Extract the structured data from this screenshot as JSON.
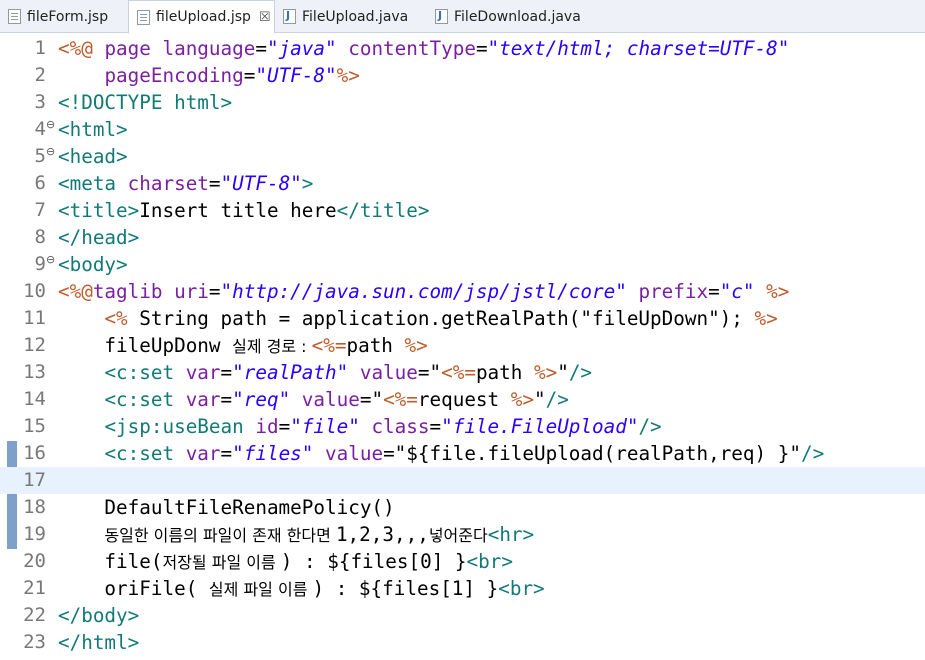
{
  "tabs": [
    {
      "label": "fileForm.jsp",
      "icon": "jsp-file-icon",
      "active": false
    },
    {
      "label": "fileUpload.jsp",
      "icon": "jsp-file-icon",
      "active": true,
      "close": "☒"
    },
    {
      "label": "FileUpload.java",
      "icon": "java-file-icon",
      "active": false
    },
    {
      "label": "FileDownload.java",
      "icon": "java-file-icon",
      "active": false
    }
  ],
  "editor": {
    "current_line": 17,
    "lines": [
      {
        "n": "1",
        "tokens": [
          [
            "dir",
            "<%@ "
          ],
          [
            "attr",
            "page "
          ],
          [
            "attr",
            "language"
          ],
          [
            "plain",
            "="
          ],
          [
            "str",
            "\"java\""
          ],
          [
            "plain",
            " "
          ],
          [
            "attr",
            "contentType"
          ],
          [
            "plain",
            "="
          ],
          [
            "str",
            "\"text/html; charset=UTF-8\""
          ]
        ]
      },
      {
        "n": "2",
        "tokens": [
          [
            "plain",
            "    "
          ],
          [
            "attr",
            "pageEncoding"
          ],
          [
            "plain",
            "="
          ],
          [
            "str",
            "\"UTF-8\""
          ],
          [
            "dir",
            "%>"
          ]
        ]
      },
      {
        "n": "3",
        "tokens": [
          [
            "tag",
            "<!DOCTYPE html>"
          ]
        ]
      },
      {
        "n": "4",
        "fold": "⊖",
        "tokens": [
          [
            "tag",
            "<html>"
          ]
        ]
      },
      {
        "n": "5",
        "fold": "⊖",
        "tokens": [
          [
            "tag",
            "<head>"
          ]
        ]
      },
      {
        "n": "6",
        "tokens": [
          [
            "tag",
            "<meta "
          ],
          [
            "attr",
            "charset"
          ],
          [
            "plain",
            "="
          ],
          [
            "str",
            "\"UTF-8\""
          ],
          [
            "tag",
            ">"
          ]
        ]
      },
      {
        "n": "7",
        "tokens": [
          [
            "tag",
            "<title>"
          ],
          [
            "plain",
            "Insert title here"
          ],
          [
            "tag",
            "</title>"
          ]
        ]
      },
      {
        "n": "8",
        "tokens": [
          [
            "tag",
            "</head>"
          ]
        ]
      },
      {
        "n": "9",
        "fold": "⊖",
        "tokens": [
          [
            "tag",
            "<body>"
          ]
        ]
      },
      {
        "n": "10",
        "tokens": [
          [
            "dir",
            "<%@"
          ],
          [
            "attr",
            "taglib "
          ],
          [
            "attr",
            "uri"
          ],
          [
            "plain",
            "="
          ],
          [
            "str",
            "\"http://java.sun.com/jsp/jstl/core\""
          ],
          [
            "plain",
            " "
          ],
          [
            "attr",
            "prefix"
          ],
          [
            "plain",
            "="
          ],
          [
            "str",
            "\"c\""
          ],
          [
            "plain",
            " "
          ],
          [
            "dir",
            "%>"
          ]
        ]
      },
      {
        "n": "11",
        "tokens": [
          [
            "plain",
            "    "
          ],
          [
            "dir",
            "<% "
          ],
          [
            "plain",
            "String path = application.getRealPath(\"fileUpDown\"); "
          ],
          [
            "dir",
            "%>"
          ]
        ]
      },
      {
        "n": "12",
        "tokens": [
          [
            "plain",
            "    fileUpDonw "
          ],
          [
            "kor",
            "실제 경로 : "
          ],
          [
            "dir",
            "<%="
          ],
          [
            "plain",
            "path "
          ],
          [
            "dir",
            "%>"
          ]
        ]
      },
      {
        "n": "13",
        "tokens": [
          [
            "plain",
            "    "
          ],
          [
            "tag",
            "<c:set "
          ],
          [
            "attr",
            "var"
          ],
          [
            "plain",
            "="
          ],
          [
            "str",
            "\"realPath\""
          ],
          [
            "plain",
            " "
          ],
          [
            "attr",
            "value"
          ],
          [
            "plain",
            "=\""
          ],
          [
            "dir",
            "<%="
          ],
          [
            "plain",
            "path "
          ],
          [
            "dir",
            "%>"
          ],
          [
            "plain",
            "\""
          ],
          [
            "tag",
            "/>"
          ]
        ]
      },
      {
        "n": "14",
        "tokens": [
          [
            "plain",
            "    "
          ],
          [
            "tag",
            "<c:set "
          ],
          [
            "attr",
            "var"
          ],
          [
            "plain",
            "="
          ],
          [
            "str",
            "\"req\""
          ],
          [
            "plain",
            " "
          ],
          [
            "attr",
            "value"
          ],
          [
            "plain",
            "=\""
          ],
          [
            "dir",
            "<%="
          ],
          [
            "plain",
            "request "
          ],
          [
            "dir",
            "%>"
          ],
          [
            "plain",
            "\""
          ],
          [
            "tag",
            "/>"
          ]
        ]
      },
      {
        "n": "15",
        "tokens": [
          [
            "plain",
            "    "
          ],
          [
            "tag",
            "<jsp:useBean "
          ],
          [
            "attr",
            "id"
          ],
          [
            "plain",
            "="
          ],
          [
            "str",
            "\"file\""
          ],
          [
            "plain",
            " "
          ],
          [
            "attr",
            "class"
          ],
          [
            "plain",
            "="
          ],
          [
            "str",
            "\"file.FileUpload\""
          ],
          [
            "tag",
            "/>"
          ]
        ]
      },
      {
        "n": "16",
        "tokens": [
          [
            "plain",
            "    "
          ],
          [
            "tag",
            "<c:set "
          ],
          [
            "attr",
            "var"
          ],
          [
            "plain",
            "="
          ],
          [
            "str",
            "\"files\""
          ],
          [
            "plain",
            " "
          ],
          [
            "attr",
            "value"
          ],
          [
            "plain",
            "=\"${file.fileUpload(realPath,req) }\""
          ],
          [
            "tag",
            "/>"
          ]
        ]
      },
      {
        "n": "17",
        "tokens": []
      },
      {
        "n": "18",
        "tokens": [
          [
            "plain",
            "    DefaultFileRenamePolicy()"
          ]
        ]
      },
      {
        "n": "19",
        "tokens": [
          [
            "plain",
            "    "
          ],
          [
            "kor",
            "동일한 이름의 파일이 존재 한다면 "
          ],
          [
            "plain",
            "1,2,3,,,"
          ],
          [
            "kor",
            "넣어준다"
          ],
          [
            "tag",
            "<hr>"
          ]
        ]
      },
      {
        "n": "20",
        "tokens": [
          [
            "plain",
            "    file("
          ],
          [
            "kor",
            "저장될 파일 이름 "
          ],
          [
            "plain",
            ") : ${files[0] }"
          ],
          [
            "tag",
            "<br>"
          ]
        ]
      },
      {
        "n": "21",
        "tokens": [
          [
            "plain",
            "    oriFile( "
          ],
          [
            "kor",
            "실제 파일 이름 "
          ],
          [
            "plain",
            ") : ${files[1] }"
          ],
          [
            "tag",
            "<br>"
          ]
        ]
      },
      {
        "n": "22",
        "tokens": [
          [
            "tag",
            "</body>"
          ]
        ]
      },
      {
        "n": "23",
        "tokens": [
          [
            "tag",
            "</html>"
          ]
        ]
      }
    ]
  }
}
